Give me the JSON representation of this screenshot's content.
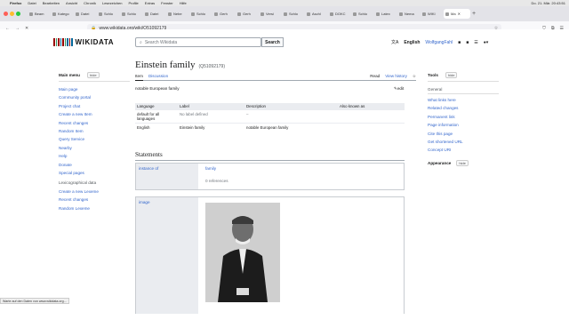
{
  "mac_menu": [
    "Firefox",
    "Datei",
    "Bearbeiten",
    "Ansicht",
    "Chronik",
    "Lesezeichen",
    "Profile",
    "Extras",
    "Fenster",
    "Hilfe"
  ],
  "clock": "Do. 21. Mär. 20:43:51",
  "tabs": [
    "Beam",
    "Katego",
    "Datei",
    "Schlo",
    "Schlo",
    "Datei",
    "Nebe",
    "Schlo",
    "Gerh",
    "Gerh",
    "Versi",
    "Schlo",
    "Aschl",
    "DOKC",
    "Schlo",
    "Latex",
    "Nema",
    "WIKI",
    "Ma"
  ],
  "active_tab": "Ma",
  "url": "www.wikidata.org/wiki/Q51092179",
  "logo_text": "WIKIDATA",
  "search": {
    "placeholder": "Search Wikidata",
    "button": "Search"
  },
  "top_right": {
    "language": "English",
    "user": "WolfgangFahl"
  },
  "main_menu": {
    "title": "Main menu",
    "hide": "hide",
    "items": [
      "Main page",
      "Community portal",
      "Project chat",
      "Create a new Item",
      "Recent changes",
      "Random Item",
      "Query Service",
      "Nearby",
      "Help",
      "Donate",
      "Special pages"
    ],
    "lexeme_head": "Lexicographical data",
    "lexeme_items": [
      "Create a new Lexeme",
      "Recent changes",
      "Random Lexeme"
    ]
  },
  "tools": {
    "title": "Tools",
    "hide": "hide",
    "sub": "General",
    "items": [
      "What links here",
      "Related changes",
      "Permanent link",
      "Page information",
      "Cite this page",
      "Get shortened URL",
      "Concept URI"
    ],
    "appearance": "Appearance",
    "appearance_hide": "hide"
  },
  "item": {
    "title": "Einstein family",
    "qid": "(Q51092179)",
    "tab_item": "Item",
    "tab_discussion": "Discussion",
    "read": "Read",
    "view_history": "View history",
    "description": "notable European family",
    "edit": "edit"
  },
  "lang_table": {
    "headers": [
      "Language",
      "Label",
      "Description",
      "Also known as"
    ],
    "rows": [
      [
        "default for all languages",
        "No label defined",
        "–",
        ""
      ],
      [
        "English",
        "Einstein family",
        "notable European family",
        ""
      ]
    ]
  },
  "statements": {
    "heading": "Statements",
    "claims": [
      {
        "property": "instance of",
        "value": "family",
        "refs": "0 references"
      },
      {
        "property": "image",
        "value": ""
      }
    ]
  },
  "statusbar": "Warte auf den Daten von www.wikidata.org..."
}
